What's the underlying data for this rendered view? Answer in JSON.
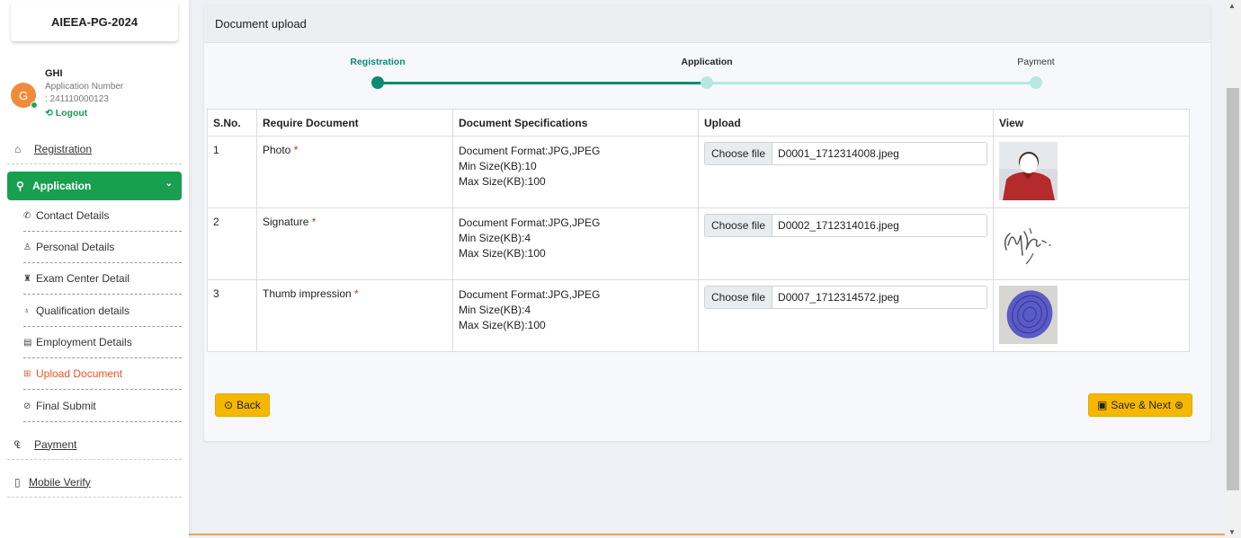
{
  "app_title": "AIEEA-PG-2024",
  "user": {
    "initial": "G",
    "name": "GHI",
    "app_number_label": "Application Number",
    "app_number": ": 241110000123",
    "logout_label": "Logout"
  },
  "nav": {
    "registration": "Registration",
    "application": "Application",
    "sub_items": [
      "Contact Details",
      "Personal Details",
      "Exam Center Detail",
      "Qualification details",
      "Employment Details",
      "Upload Document",
      "Final Submit"
    ],
    "payment": "Payment",
    "mobile_verify": "Mobile Verify"
  },
  "page": {
    "title": "Document upload",
    "steps": [
      "Registration",
      "Application",
      "Payment"
    ],
    "colors": {
      "complete": "#0c8a74",
      "pending": "#b5e8e1",
      "accent": "#18a04f",
      "button": "#f5b800",
      "active_nav": "#e8562a"
    }
  },
  "table": {
    "headers": [
      "S.No.",
      "Require Document",
      "Document Specifications",
      "Upload",
      "View"
    ],
    "rows": [
      {
        "sno": "1",
        "doc": "Photo",
        "required": "*",
        "spec": [
          "Document Format:JPG,JPEG",
          "Min Size(KB):10",
          "Max Size(KB):100"
        ],
        "button": "Choose file",
        "file": "D0001_1712314008.jpeg"
      },
      {
        "sno": "2",
        "doc": "Signature",
        "required": "*",
        "spec": [
          "Document Format:JPG,JPEG",
          "Min Size(KB):4",
          "Max Size(KB):100"
        ],
        "button": "Choose file",
        "file": "D0002_1712314016.jpeg"
      },
      {
        "sno": "3",
        "doc": "Thumb impression",
        "required": "*",
        "spec": [
          "Document Format:JPG,JPEG",
          "Min Size(KB):4",
          "Max Size(KB):100"
        ],
        "button": "Choose file",
        "file": "D0007_1712314572.jpeg"
      }
    ]
  },
  "buttons": {
    "back": "Back",
    "save_next": "Save & Next"
  }
}
